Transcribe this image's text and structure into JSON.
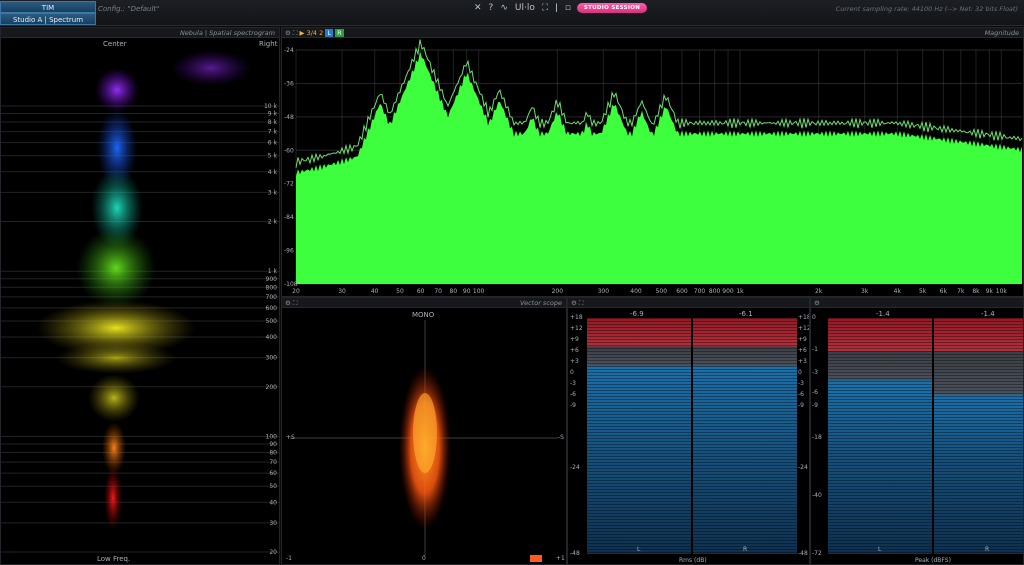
{
  "topbar": {
    "tab_top": "TIM",
    "tab_bottom": "Studio A | Spectrum",
    "config": "Config.: \"Default\"",
    "icons": [
      "✕",
      "?",
      "∿",
      "Ul·lo",
      "⛶",
      "ǀ",
      "▫"
    ],
    "studio_session": "STUDIO SESSION",
    "sample_rate": "Current sampling rate: 44100 Hz (--> Net: 32 bits Float)"
  },
  "spatial": {
    "title": "Nebula | Spatial spectrogram",
    "label_center": "Center",
    "label_right": "Right",
    "label_bottom": "Low Freq.",
    "freq_ticks": [
      "10 k",
      "9 k",
      "8 k",
      "7 k",
      "6 k",
      "5 k",
      "4 k",
      "3 k",
      "2 k",
      "1 k",
      "900",
      "800",
      "700",
      "600",
      "500",
      "400",
      "300",
      "200",
      "100",
      "90",
      "80",
      "70",
      "60",
      "50",
      "40",
      "30",
      "20"
    ]
  },
  "magnitude": {
    "title": "Magnitude",
    "header_tools": "▶ 3/4  2",
    "db_ticks": [
      "-24",
      "-36",
      "-48",
      "-60",
      "-72",
      "-84",
      "-96",
      "-108"
    ],
    "freq_ticks": [
      "20",
      "30",
      "40",
      "50",
      "60",
      "70",
      "80",
      "90",
      "100",
      "200",
      "300",
      "400",
      "500",
      "600",
      "700",
      "800",
      "900",
      "1k",
      "2k",
      "3k",
      "4k",
      "5k",
      "6k",
      "7k",
      "8k",
      "9k",
      "10k"
    ]
  },
  "vector": {
    "title": "Vector scope",
    "label_top": "MONO",
    "label_left": "+S",
    "label_right": "-S",
    "label_bottom_left": "-1",
    "label_bottom_center": "0",
    "label_bottom_right": "+1"
  },
  "rms": {
    "left_value": "-6.9",
    "right_value": "-6.1",
    "label_left_channel": "L",
    "label_right_channel": "R",
    "axis_title": "Rms (dB)",
    "scale": [
      "+18",
      "+12",
      "+9",
      "+6",
      "+3",
      "0",
      "-3",
      "-6",
      "-9",
      "-24",
      "-48"
    ],
    "scale_right": [
      "+18",
      "+12",
      "+9",
      "+6",
      "+3",
      "0",
      "-3",
      "-6",
      "-9",
      "-24",
      "-48"
    ]
  },
  "peak": {
    "left_value": "-1.4",
    "right_value": "-1.4",
    "label_left_channel": "L",
    "label_right_channel": "R",
    "axis_title": "Peak (dBFS)",
    "scale": [
      "0",
      "-1",
      "-3",
      "-6",
      "-9",
      "-18",
      "-40",
      "-72"
    ]
  },
  "colors": {
    "accent_blue": "#2a5a80",
    "spectrum_green": "#33ff33",
    "studio_pink": "#e83f8c",
    "meter_red": "#a0202c",
    "meter_blue": "#1c5f8f"
  }
}
